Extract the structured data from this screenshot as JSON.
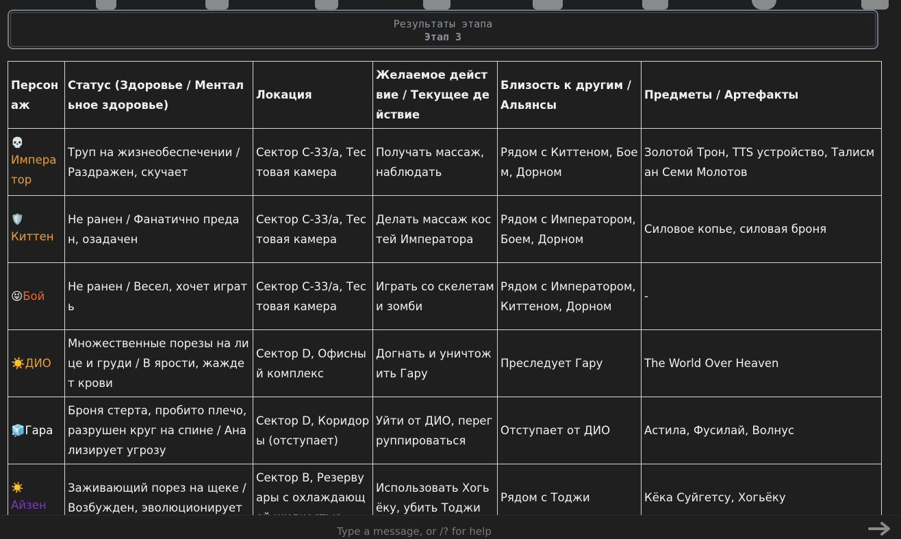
{
  "stage": {
    "title": "Результаты этапа",
    "subtitle": "Этап 3"
  },
  "table": {
    "headers": [
      "Персонаж",
      "Статус (Здоровье / Ментальное здоровье)",
      "Локация",
      "Желаемое действие / Текущее действие",
      "Близость к другим / Альянсы",
      "Предметы / Артефакты"
    ],
    "rows": [
      {
        "emoji": "💀",
        "name": "Император",
        "status": "Труп на жизнеобеспечении / Раздражен, скучает",
        "location": "Сектор С-33/а, Тестовая камера",
        "action": "Получать массаж, наблюдать",
        "proximity": "Рядом с Киттеном, Боем, Дорном",
        "items": "Золотой Трон, TTS устройство, Талисман Семи Молотов"
      },
      {
        "emoji": "🛡️",
        "name": "Киттен",
        "status": "Не ранен / Фанатично предан, озадачен",
        "location": "Сектор С-33/а, Тестовая камера",
        "action": "Делать массаж костей Императора",
        "proximity": "Рядом с Императором, Боем, Дорном",
        "items": "Силовое копье, силовая броня"
      },
      {
        "emoji": "😝",
        "name": "Бой",
        "status": "Не ранен / Весел, хочет играть",
        "location": "Сектор С-33/а, Тестовая камера",
        "action": "Играть со скелетами зомби",
        "proximity": "Рядом с Императором, Киттеном, Дорном",
        "items": "-"
      },
      {
        "emoji": "☀️",
        "name": "ДИО",
        "status": "Множественные порезы на лице и груди / В ярости, жаждет крови",
        "location": "Сектор D, Офисный комплекс",
        "action": "Догнать и уничтожить Гару",
        "proximity": "Преследует Гару",
        "items": "The World Over Heaven"
      },
      {
        "emoji": "🧊",
        "name": "Гара",
        "status": "Броня стерта, пробито плечо, разрушен круг на спине / Анализирует угрозу",
        "location": "Сектор D, Коридоры (отступает)",
        "action": "Уйти от ДИО, перегруппироваться",
        "proximity": "Отступает от ДИО",
        "items": "Астила, Фусилай, Волнус"
      },
      {
        "emoji": "☀️",
        "name": "Айзен",
        "status": "Заживающий порез на щеке / Возбужден, эволюционирует",
        "location": "Сектор B, Резервуары с охлаждающей жидкостью",
        "action": "Использовать Хогьёку, убить Тоджи",
        "proximity": "Рядом с Тоджи",
        "items": "Кёка Суйгетсу, Хогьёку"
      }
    ]
  },
  "input": {
    "placeholder": "Type a message, or /? for help"
  },
  "colors": {
    "background": "#1f1f1f",
    "border": "#d8d8d8",
    "orange": "#e7a12b",
    "red": "#e86a2a",
    "purple": "#7a38c8"
  },
  "icons": {
    "send": "send-arrow-icon"
  }
}
